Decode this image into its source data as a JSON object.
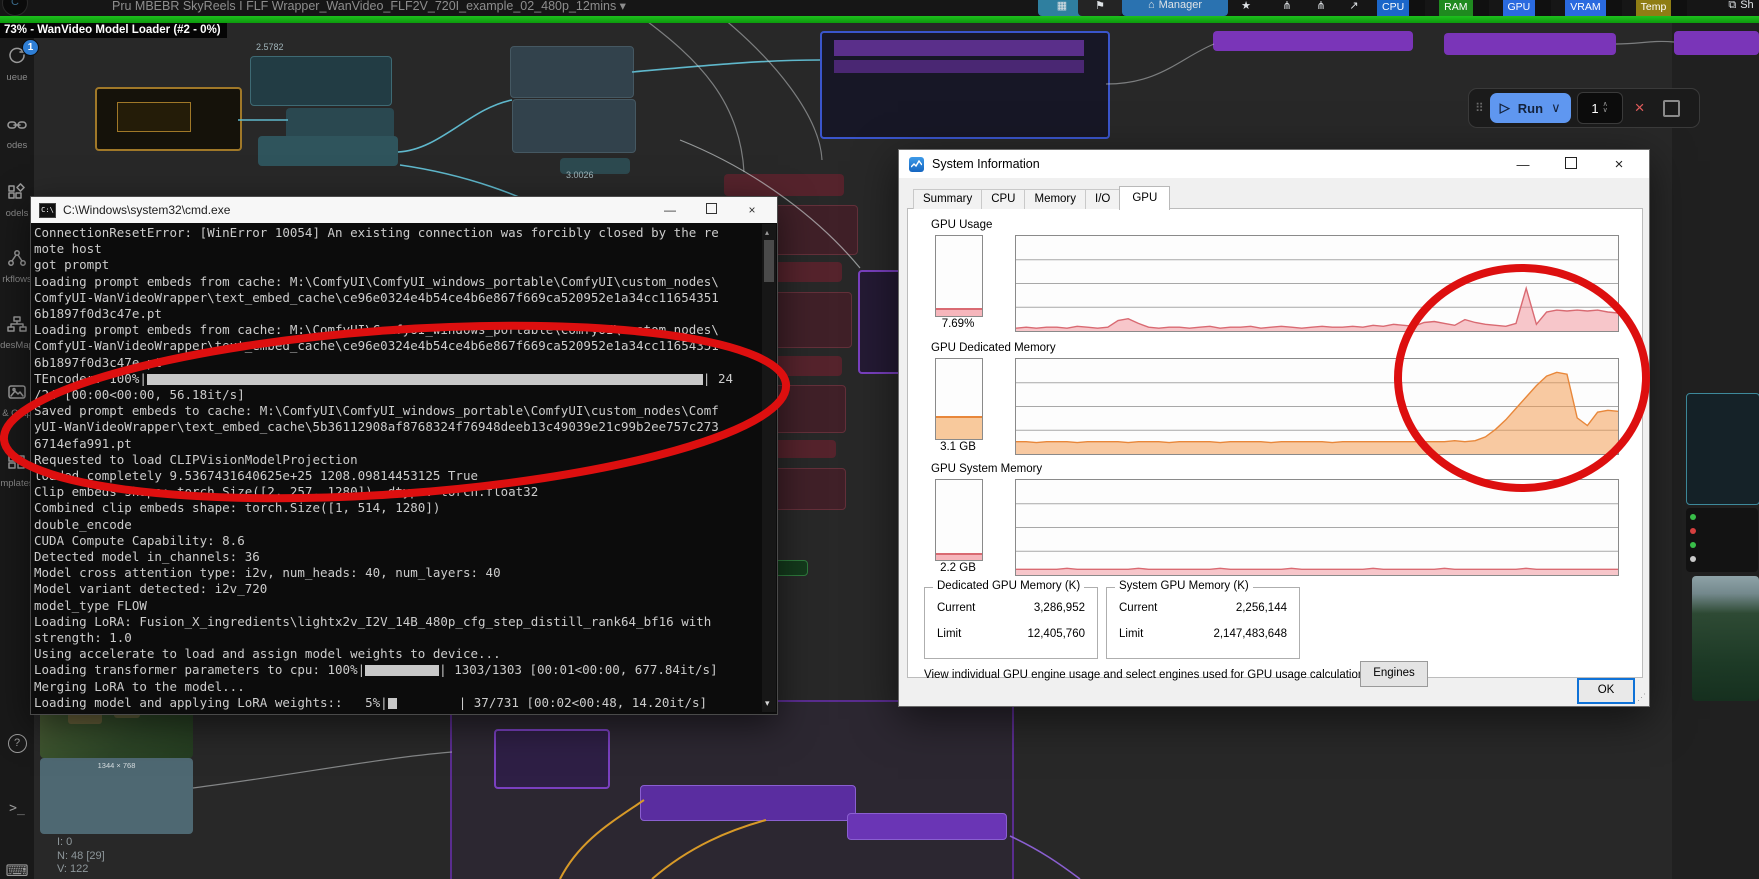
{
  "topbar": {
    "workflow_tab": "Pru   MBEBR   SkyReels I FLF   Wrapper_WanVideo_FLF2V_720I_example_02_480p_12mins  ▾",
    "manager_label": "Manager",
    "share_label": "Sh",
    "monitors": [
      {
        "label": "CPU",
        "color": "#1b66c9"
      },
      {
        "label": "RAM",
        "color": "#1f8a1f"
      },
      {
        "label": "GPU",
        "color": "#2a6adf"
      },
      {
        "label": "VRAM",
        "color": "#2a6adf"
      },
      {
        "label": "Temp",
        "color": "#8f7d14"
      }
    ]
  },
  "progress": {
    "label": "73% - WanVideo Model Loader (#2 - 0%)",
    "bar_color": "#0fa80f"
  },
  "sidebar": {
    "queue_badge": "1",
    "items": [
      {
        "icon": "queue-icon",
        "label": "ueue"
      },
      {
        "icon": "nodes-icon",
        "label": "odes"
      },
      {
        "icon": "models-icon",
        "label": "odels"
      },
      {
        "icon": "workflows-icon",
        "label": "rkflows"
      },
      {
        "icon": "nodes-map-icon",
        "label": "desMap"
      },
      {
        "icon": "outputs-icon",
        "label": "& Outp"
      },
      {
        "icon": "templates-icon",
        "label": "mplates"
      }
    ],
    "bottom_items": [
      {
        "icon": "help-icon"
      },
      {
        "icon": "terminal-icon"
      },
      {
        "icon": "keyboard-icon"
      }
    ]
  },
  "run_toolbar": {
    "run_label": "Run",
    "queue_count": "1"
  },
  "cmd": {
    "title": "C:\\Windows\\system32\\cmd.exe",
    "lines": [
      {
        "t": "ConnectionResetError: [WinError 10054] An existing connection was forcibly closed by the re"
      },
      {
        "t": "mote host"
      },
      {
        "t": "got prompt"
      },
      {
        "t": "Loading prompt embeds from cache: M:\\ComfyUI\\ComfyUI_windows_portable\\ComfyUI\\custom_nodes\\"
      },
      {
        "t": "ComfyUI-WanVideoWrapper\\text_embed_cache\\ce96e0324e4b54ce4b6e867f669ca520952e1a34cc11654351"
      },
      {
        "t": "6b1897f0d3c47e.pt"
      },
      {
        "t": "Loading prompt embeds from cache: M:\\ComfyUI\\ComfyUI_windows_portable\\ComfyUI\\custom_nodes\\"
      },
      {
        "t": "ComfyUI-WanVideoWrapper\\text_embed_cache\\ce96e0324e4b54ce4b6e867f669ca520952e1a34cc11654351"
      },
      {
        "t": "6b1897f0d3c47e.pt"
      },
      {
        "pre": "TEncoder: 100%|",
        "bar": 556,
        "gap": 0,
        "post": "| 24"
      },
      {
        "t": "/24 [00:00<00:00, 56.18it/s]"
      },
      {
        "t": "Saved prompt embeds to cache: M:\\ComfyUI\\ComfyUI_windows_portable\\ComfyUI\\custom_nodes\\Comf"
      },
      {
        "t": "yUI-WanVideoWrapper\\text_embed_cache\\5b36112908af8768324f76948deeb13c49039e21c99b2ee757c273"
      },
      {
        "t": "6714efa991.pt"
      },
      {
        "t": "Requested to load CLIPVisionModelProjection"
      },
      {
        "t": "loaded completely 9.5367431640625e+25 1208.09814453125 True"
      },
      {
        "t": "Clip embeds shape: torch.Size([2, 257, 1280]), dtype: torch.float32"
      },
      {
        "t": "Combined clip embeds shape: torch.Size([1, 514, 1280])"
      },
      {
        "t": "double_encode"
      },
      {
        "t": "CUDA Compute Capability: 8.6"
      },
      {
        "t": "Detected model in_channels: 36"
      },
      {
        "t": "Model cross attention type: i2v, num_heads: 40, num_layers: 40"
      },
      {
        "t": "Model variant detected: i2v_720"
      },
      {
        "t": "model_type FLOW"
      },
      {
        "t": "Loading LoRA: Fusion_X_ingredients\\lightx2v_I2V_14B_480p_cfg_step_distill_rank64_bf16 with"
      },
      {
        "t": "strength: 1.0"
      },
      {
        "t": "Using accelerate to load and assign model weights to device..."
      },
      {
        "pre": "Loading transformer parameters to cpu: 100%|",
        "bar": 74,
        "gap": 0,
        "post": "| 1303/1303 [00:01<00:00, 677.84it/s]"
      },
      {
        "t": "Merging LoRA to the model..."
      },
      {
        "pre": "Loading model and applying LoRA weights::   5%|",
        "bar": 9,
        "gap": 62,
        "post": "| 37/731 [00:02<00:48, 14.20it/s]"
      }
    ]
  },
  "sysinfo": {
    "title": "System Information",
    "tabs": [
      "Summary",
      "CPU",
      "Memory",
      "I/O",
      "GPU"
    ],
    "active_tab": "GPU",
    "sections": [
      {
        "label": "GPU Usage",
        "gauge_text": "7.69%",
        "gauge_fill": 8,
        "fill": "#f6b6bc",
        "line": "#d96a72"
      },
      {
        "label": "GPU Dedicated Memory",
        "gauge_text": "3.1 GB",
        "gauge_fill": 26,
        "fill": "#f8c99c",
        "line": "#e8873a"
      },
      {
        "label": "GPU System Memory",
        "gauge_text": "2.2 GB",
        "gauge_fill": 6,
        "fill": "#f6b6bc",
        "line": "#d96a72"
      }
    ],
    "chart_data": {
      "type": "area",
      "series": [
        {
          "name": "gpu_usage_pct",
          "values": [
            3,
            4,
            3,
            4,
            4,
            3,
            5,
            4,
            3,
            4,
            11,
            13,
            8,
            4,
            3,
            4,
            4,
            3,
            4,
            5,
            3,
            4,
            4,
            5,
            3,
            4,
            5,
            4,
            3,
            4,
            5,
            4,
            4,
            5,
            4,
            6,
            5,
            7,
            6,
            5,
            9,
            10,
            8,
            6,
            12,
            9,
            7,
            6,
            5,
            8,
            45,
            7,
            20,
            22,
            21,
            22,
            21,
            22,
            20,
            19
          ]
        },
        {
          "name": "gpu_dedicated_mem_pct",
          "values": [
            13,
            13,
            12,
            13,
            13,
            13,
            12,
            13,
            13,
            13,
            13,
            12,
            13,
            13,
            13,
            12,
            13,
            13,
            13,
            13,
            12,
            13,
            13,
            13,
            13,
            12,
            13,
            13,
            13,
            13,
            13,
            12,
            13,
            13,
            13,
            13,
            13,
            13,
            13,
            13,
            13,
            13,
            13,
            14,
            13,
            14,
            18,
            26,
            36,
            48,
            60,
            72,
            82,
            86,
            84,
            38,
            30,
            44,
            46,
            45
          ]
        },
        {
          "name": "gpu_system_mem_pct",
          "values": [
            6,
            6,
            6,
            6,
            6,
            7,
            6,
            6,
            6,
            6,
            6,
            6,
            7,
            6,
            6,
            6,
            6,
            6,
            6,
            6,
            7,
            6,
            6,
            6,
            6,
            6,
            6,
            7,
            6,
            6,
            6,
            6,
            6,
            6,
            6,
            7,
            6,
            6,
            6,
            6,
            6,
            6,
            7,
            6,
            6,
            6,
            6,
            6,
            6,
            6,
            7,
            6,
            6,
            6,
            6,
            6,
            6,
            6,
            6,
            6
          ]
        }
      ],
      "ylim": [
        0,
        100
      ],
      "grid": true
    },
    "groups": [
      {
        "title": "Dedicated GPU Memory (K)",
        "rows": [
          [
            "Current",
            "3,286,952"
          ],
          [
            "Limit",
            "12,405,760"
          ]
        ]
      },
      {
        "title": "System GPU Memory (K)",
        "rows": [
          [
            "Current",
            "2,256,144"
          ],
          [
            "Limit",
            "2,147,483,648"
          ]
        ]
      }
    ],
    "engines_text": "View individual GPU engine usage and select engines used for GPU usage calculations:",
    "engines_button": "Engines",
    "ok_button": "OK"
  },
  "canvas": {
    "node_badges": [
      "2.5782",
      "3.0026"
    ],
    "preview_caption": "1344 × 768",
    "preview_stats": [
      "I: 0",
      "N: 48 [29]",
      "V: 122"
    ]
  }
}
